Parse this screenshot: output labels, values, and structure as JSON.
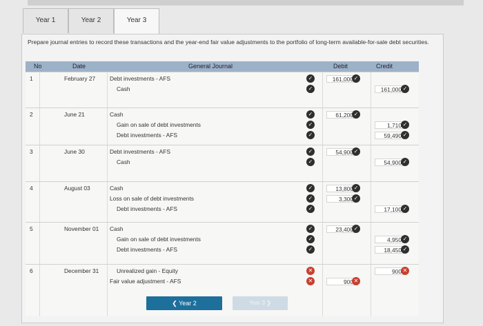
{
  "tabs": [
    "Year 1",
    "Year 2",
    "Year 3"
  ],
  "instructions": "Prepare journal entries to record these transactions and the year-end fair value adjustments to the portfolio of long-term available-for-sale debt securities.",
  "headers": {
    "no": "No",
    "date": "Date",
    "journal": "General Journal",
    "debit": "Debit",
    "credit": "Credit"
  },
  "entries": [
    {
      "no": "1",
      "date": "February 27",
      "lines": [
        {
          "account": "Debt investments - AFS",
          "debit": "161,000",
          "credit": "",
          "status": "correct"
        },
        {
          "account": "Cash",
          "debit": "",
          "credit": "161,000",
          "status": "correct"
        }
      ]
    },
    {
      "no": "2",
      "date": "June 21",
      "lines": [
        {
          "account": "Cash",
          "debit": "61,200",
          "credit": "",
          "status": "correct"
        },
        {
          "account": "Gain on sale of debt investments",
          "debit": "",
          "credit": "1,710",
          "status": "correct"
        },
        {
          "account": "Debt investments - AFS",
          "debit": "",
          "credit": "59,490",
          "status": "correct"
        }
      ]
    },
    {
      "no": "3",
      "date": "June 30",
      "lines": [
        {
          "account": "Debt investments - AFS",
          "debit": "54,900",
          "credit": "",
          "status": "correct"
        },
        {
          "account": "Cash",
          "debit": "",
          "credit": "54,900",
          "status": "correct"
        }
      ]
    },
    {
      "no": "4",
      "date": "August 03",
      "lines": [
        {
          "account": "Cash",
          "debit": "13,800",
          "credit": "",
          "status": "correct"
        },
        {
          "account": "Loss on sale of debt investments",
          "debit": "3,300",
          "credit": "",
          "status": "correct"
        },
        {
          "account": "Debt investments - AFS",
          "debit": "",
          "credit": "17,100",
          "status": "correct"
        }
      ]
    },
    {
      "no": "5",
      "date": "November 01",
      "lines": [
        {
          "account": "Cash",
          "debit": "23,400",
          "credit": "",
          "status": "correct"
        },
        {
          "account": "Gain on sale of debt investments",
          "debit": "",
          "credit": "4,950",
          "status": "correct"
        },
        {
          "account": "Debt investments - AFS",
          "debit": "",
          "credit": "18,450",
          "status": "correct"
        }
      ]
    },
    {
      "no": "6",
      "date": "December 31",
      "lines": [
        {
          "account": "Unrealized gain - Equity",
          "debit": "",
          "credit": "900",
          "status": "incorrect"
        },
        {
          "account": "Fair value adjustment - AFS",
          "debit": "900",
          "credit": "",
          "status": "incorrect"
        }
      ]
    }
  ],
  "nav": {
    "prev": "Year 2",
    "next": "Year 3"
  },
  "colors": {
    "header": "#9cb2c8",
    "button": "#1d6f9c",
    "correct": "#2f2f2f",
    "incorrect": "#c8402f"
  }
}
